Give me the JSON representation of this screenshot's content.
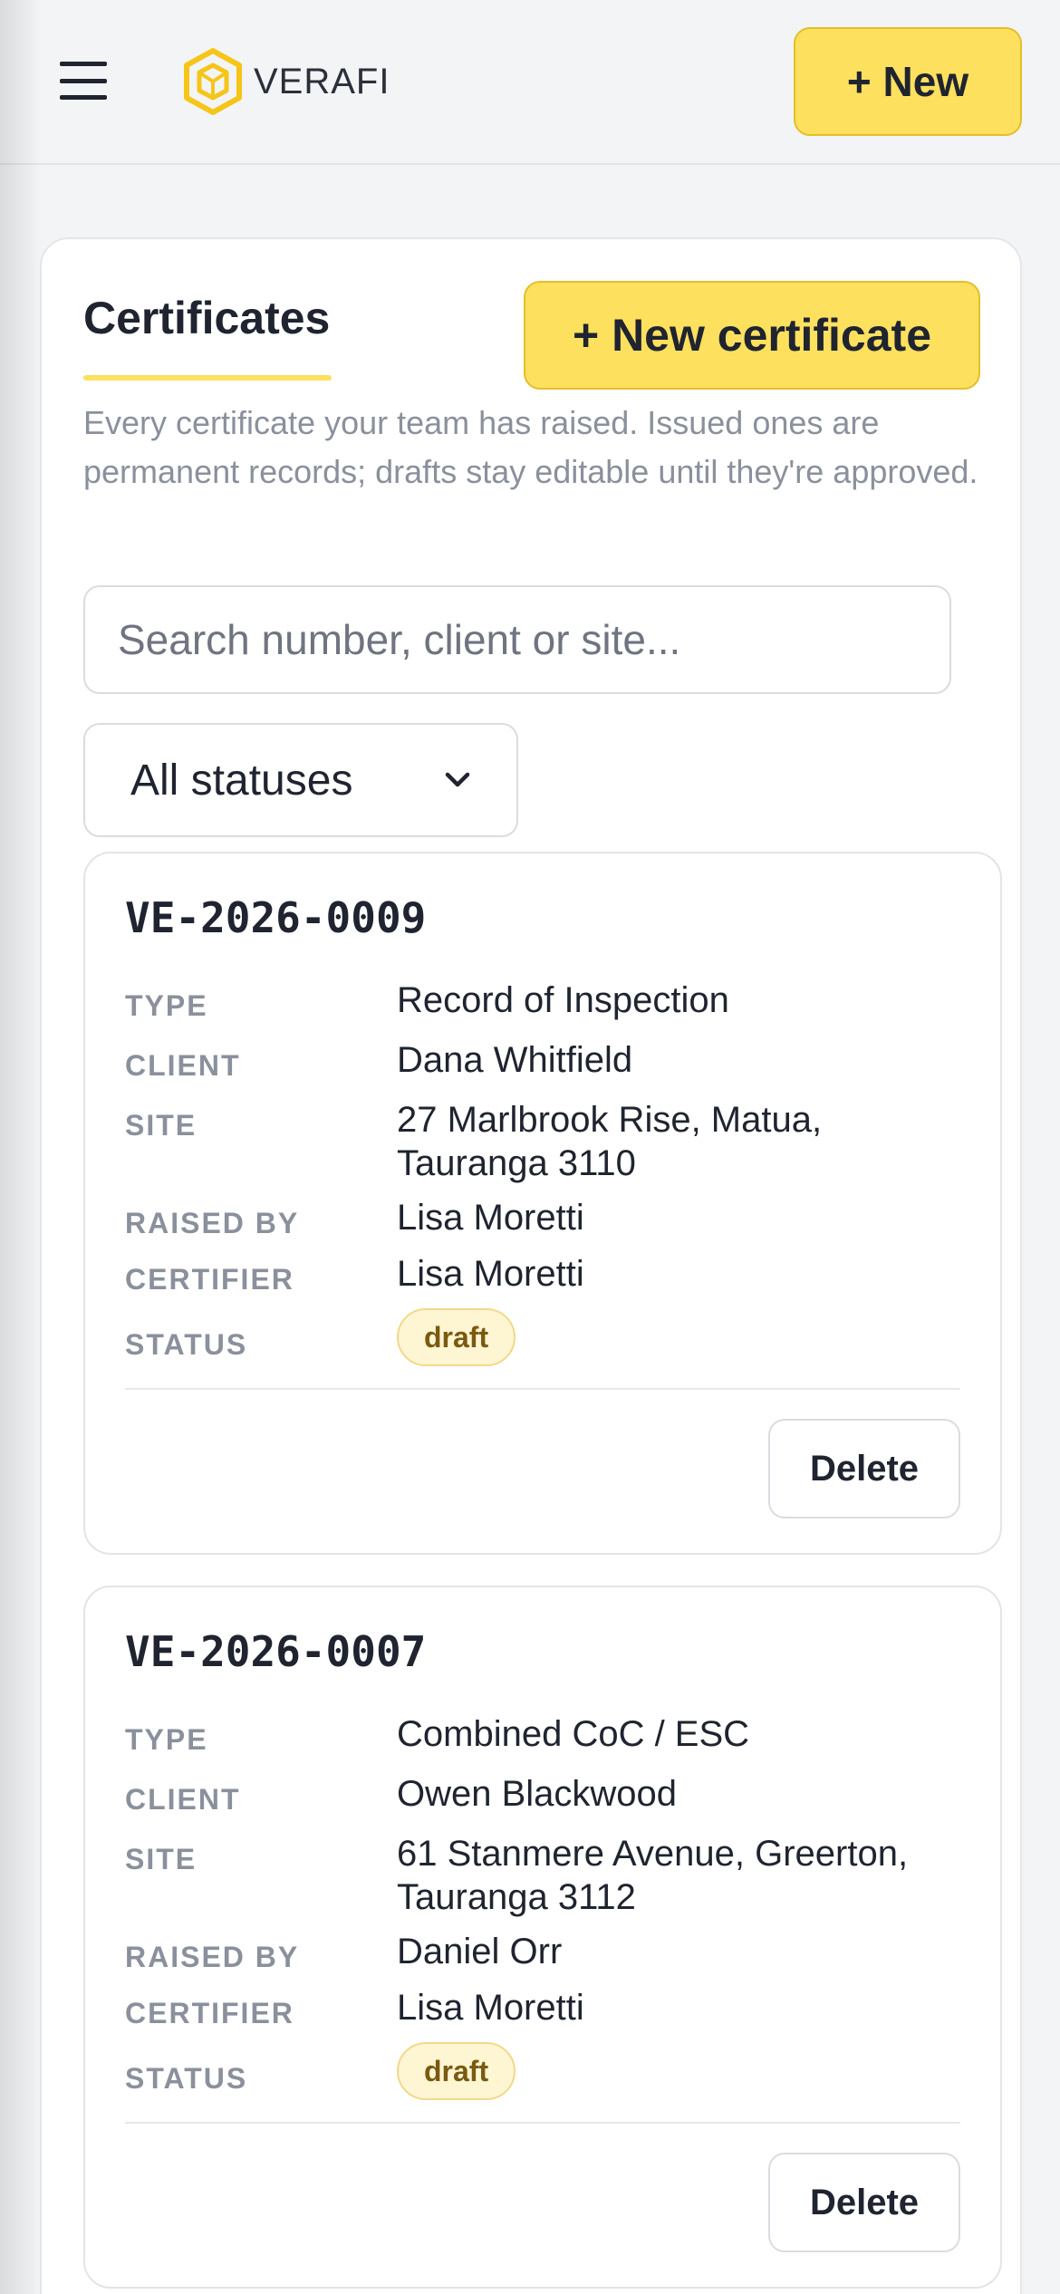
{
  "header": {
    "brand": "VERAFI",
    "new_label": "+ New"
  },
  "page": {
    "tab_title": "Certificates",
    "new_certificate_label": "+ New certificate",
    "intro": "Every certificate your team has raised. Issued ones are permanent records; drafts stay editable until they're approved.",
    "search_placeholder": "Search number, client or site...",
    "status_filter": "All statuses"
  },
  "labels": {
    "type": "TYPE",
    "client": "CLIENT",
    "site": "SITE",
    "raised_by": "RAISED BY",
    "certifier": "CERTIFIER",
    "status": "STATUS",
    "delete": "Delete"
  },
  "certificates": [
    {
      "number": "VE-2026-0009",
      "type": "Record of Inspection",
      "client": "Dana Whitfield",
      "site": "27 Marlbrook Rise, Matua, Tauranga 3110",
      "raised_by": "Lisa Moretti",
      "certifier": "Lisa Moretti",
      "status": "draft"
    },
    {
      "number": "VE-2026-0007",
      "type": "Combined CoC / ESC",
      "client": "Owen Blackwood",
      "site": "61 Stanmere Avenue, Greerton, Tauranga 3112",
      "raised_by": "Daniel Orr",
      "certifier": "Lisa Moretti",
      "status": "draft"
    }
  ],
  "colors": {
    "accent": "#fde05e",
    "accent_border": "#e3bf2a",
    "draft_badge_bg": "#fef5d3",
    "draft_badge_text": "#7a5a10"
  }
}
